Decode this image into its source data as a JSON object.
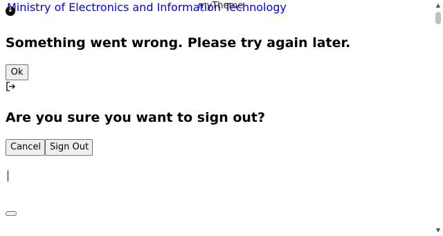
{
  "header": {
    "logo_alt": "Ministry of Electronics and Information Technology",
    "theme_name": "myTheme"
  },
  "error_dialog": {
    "message": "Something went wrong. Please try again later.",
    "ok_label": "Ok"
  },
  "signout_dialog": {
    "signout_icon": "sign-out-icon",
    "question": "Are you sure you want to sign out?",
    "cancel_label": "Cancel",
    "signout_label": "Sign Out"
  },
  "scrollbar": {
    "up_icon": "▲",
    "down_icon": "▼"
  }
}
